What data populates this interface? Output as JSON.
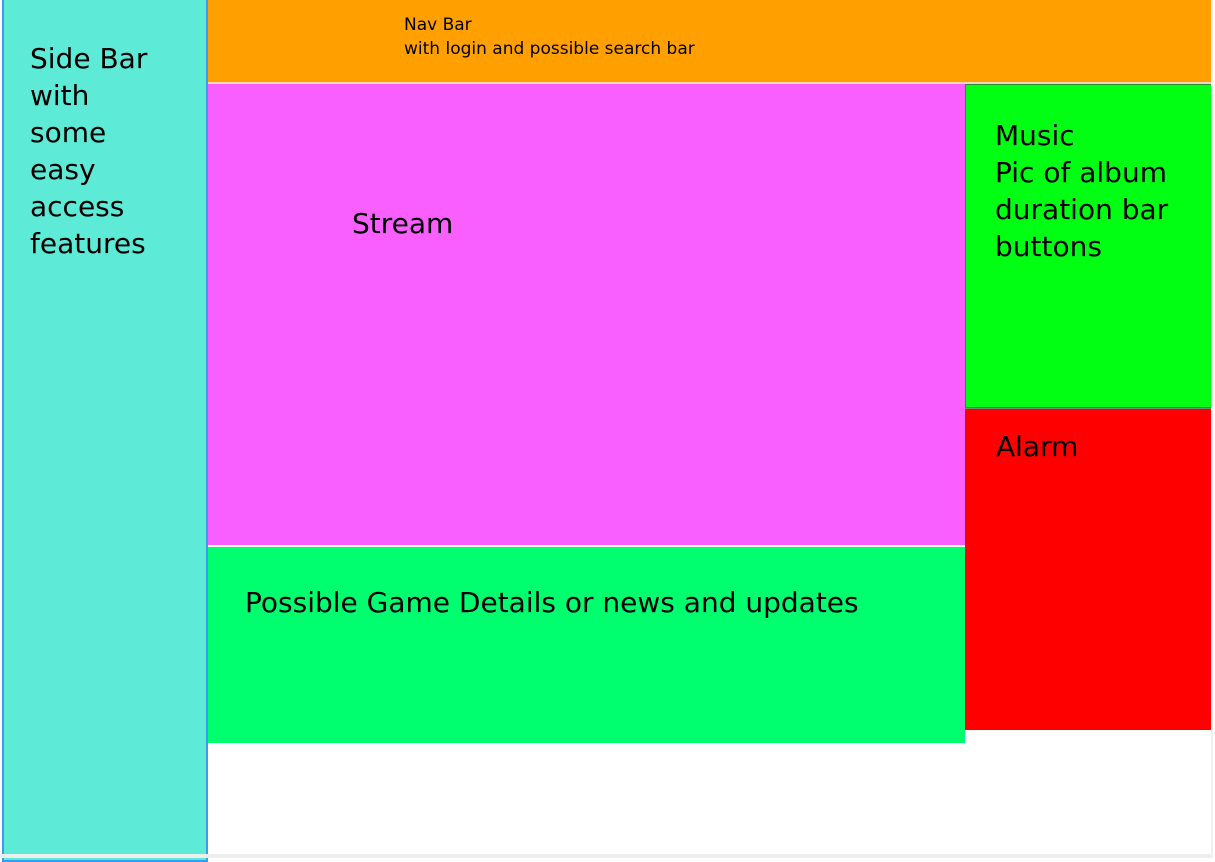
{
  "colors": {
    "sidebar": "#5dead6",
    "sidebar_border": "#3a9cf0",
    "navbar": "#ffa000",
    "stream": "#f95efe",
    "news": "#00ff6e",
    "music": "#00ff12",
    "alarm": "#ff0000",
    "background": "#ffffff"
  },
  "sidebar": {
    "lines": [
      "Side Bar",
      "with",
      "some",
      "easy",
      "access",
      "features"
    ]
  },
  "navbar": {
    "lines": [
      "Nav Bar",
      "with login and possible search bar"
    ]
  },
  "stream": {
    "title": "Stream"
  },
  "news": {
    "title": "Possible Game Details or news and updates"
  },
  "music": {
    "lines": [
      "Music",
      "Pic of album",
      "duration bar",
      "buttons"
    ]
  },
  "alarm": {
    "title": "Alarm"
  }
}
